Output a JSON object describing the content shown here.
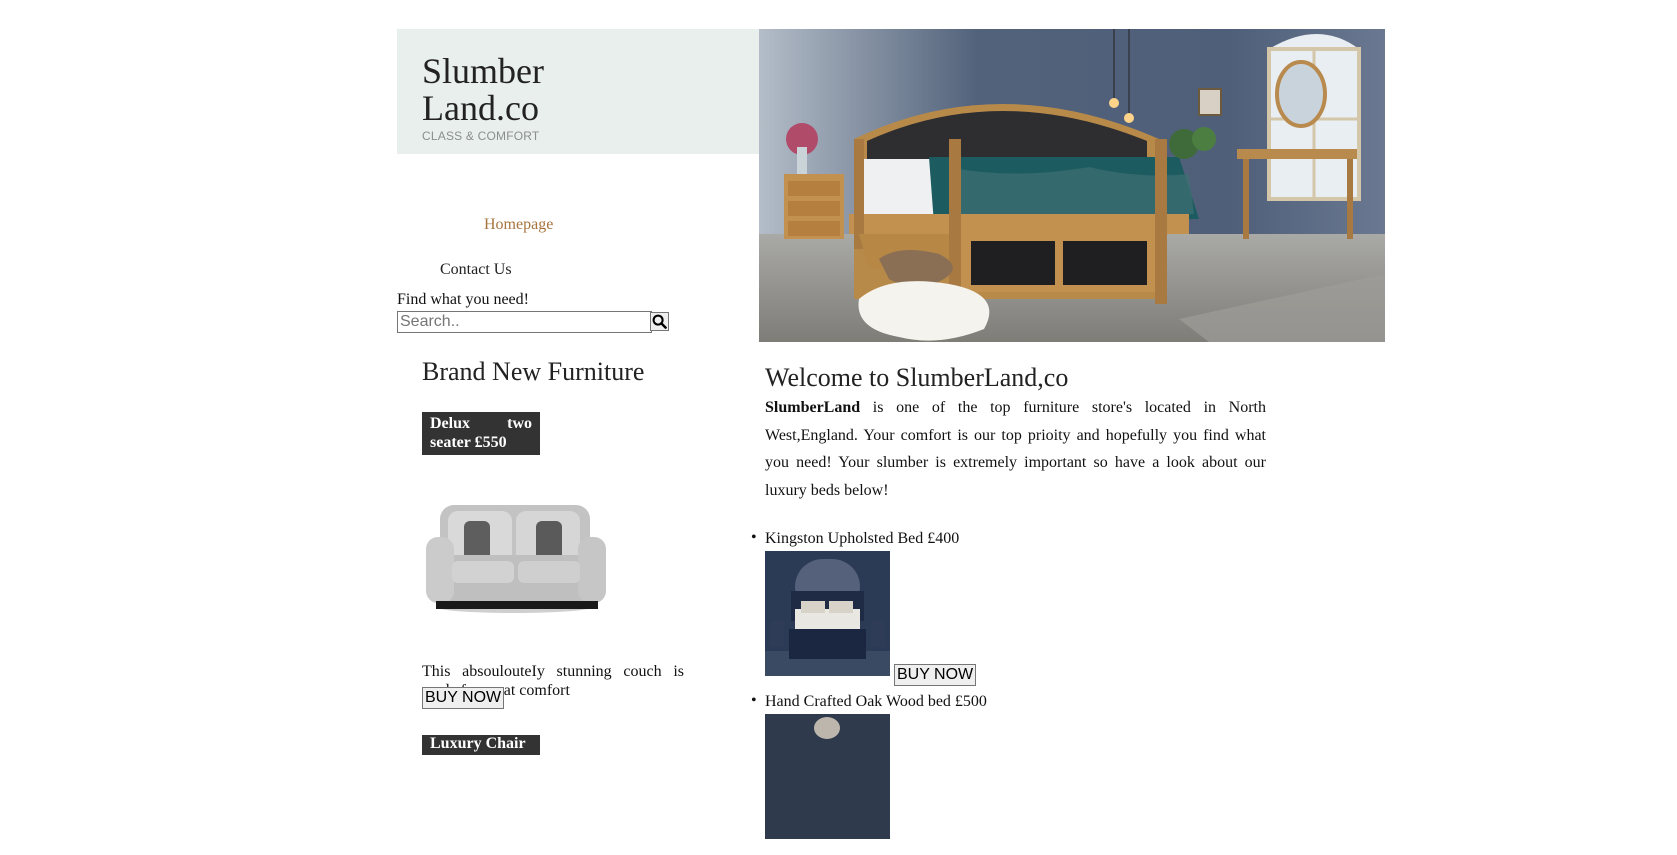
{
  "brand": {
    "title_line1": "Slumber",
    "title_line2": "Land.co",
    "tagline": "CLASS & COMFORT"
  },
  "nav": {
    "home": "Homepage",
    "contact": "Contact Us"
  },
  "search": {
    "label": "Find what you need!",
    "placeholder": "Search..",
    "button_icon": "search-icon"
  },
  "sidebar": {
    "section_title": "Brand New Furniture",
    "products": [
      {
        "tag": "Delux two seater £550",
        "description": "This absoulouteIy stunning couch is made for great comfort",
        "buy_label": "BUY NOW"
      },
      {
        "tag": "Luxury Chair"
      }
    ]
  },
  "main": {
    "welcome_title": "Welcome to SlumberLand,co",
    "intro_bold": "SlumberLand",
    "intro_text": " is one of the top furniture store's located in North West,England. Your comfort is our top prioity and hopefully you find what you need! Your slumber is extremely important so have a look about our luxury beds below!",
    "beds": [
      {
        "name": "Kingston Upholsted Bed £400",
        "buy_label": "BUY NOW"
      },
      {
        "name": "Hand Crafted Oak Wood bed £500"
      }
    ]
  },
  "colors": {
    "brand_bg": "#e9efec",
    "nav_active": "#a7743f",
    "tag_bg": "#333333"
  }
}
